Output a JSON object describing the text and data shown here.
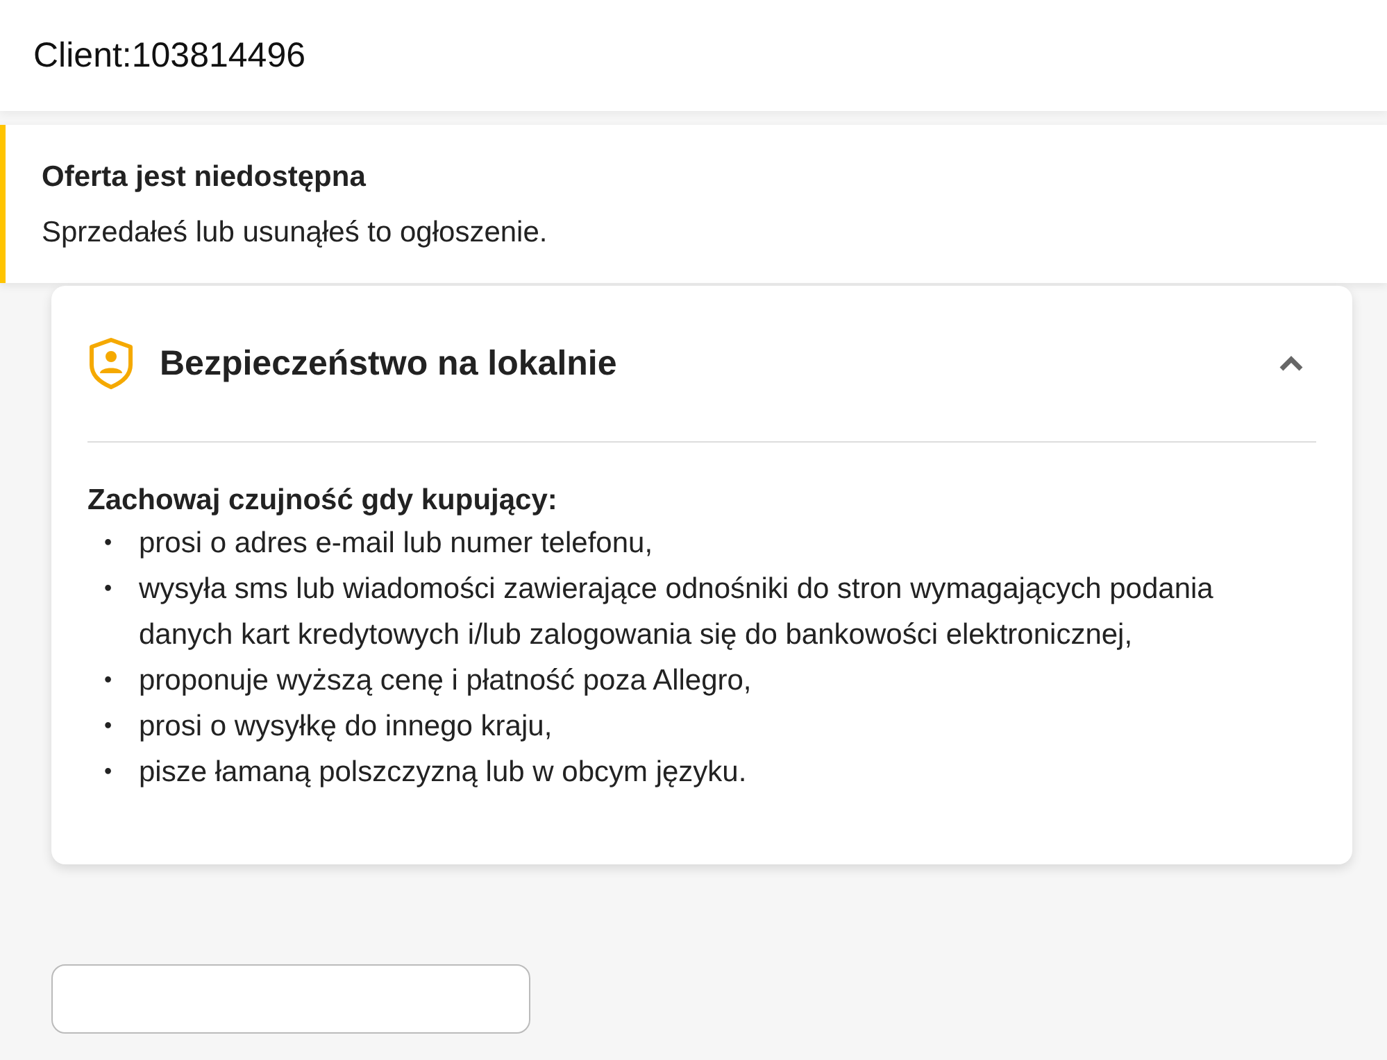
{
  "header": {
    "title": "Client:103814496"
  },
  "notice": {
    "title": "Oferta jest niedostępna",
    "message": "Sprzedałeś lub usunąłeś to ogłoszenie."
  },
  "safety_panel": {
    "title": "Bezpieczeństwo na lokalnie",
    "expanded": true,
    "heading": "Zachowaj czujność gdy kupujący:",
    "items": [
      {
        "bullet": "•",
        "text": "prosi o adres e-mail lub numer telefonu,"
      },
      {
        "bullet": "•",
        "text": "wysyła sms lub wiadomości zawierające odnośniki do stron wymagających podania danych kart kredytowych i/lub zalogowania się do bankowości elektronicznej,"
      },
      {
        "bullet": "•",
        "text": "proponuje wyższą cenę i płatność poza Allegro,"
      },
      {
        "bullet": "•",
        "text": "prosi o wysyłkę do innego kraju,"
      },
      {
        "bullet": "•",
        "text": "pisze łamaną polszczyzną lub w obcym języku."
      }
    ]
  }
}
